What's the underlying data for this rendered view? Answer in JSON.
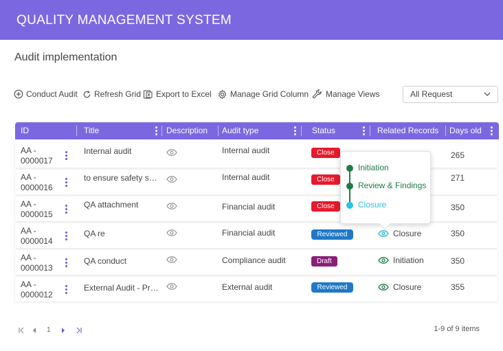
{
  "app": {
    "title": "QUALITY MANAGEMENT SYSTEM"
  },
  "page": {
    "title": "Audit implementation"
  },
  "toolbar": {
    "conduct_audit": "Conduct Audit",
    "refresh_grid": "Refresh Grid",
    "export_excel": "Export to Excel",
    "manage_columns": "Manage Grid Column",
    "manage_views": "Manage Views"
  },
  "filter": {
    "selected": "All Request"
  },
  "grid": {
    "columns": [
      "ID",
      "Title",
      "Description",
      "Audit type",
      "Status",
      "Related Records",
      "Days old"
    ],
    "rows": [
      {
        "id_line1": "AA -",
        "id_line2": "0000017",
        "title": "Internal audit",
        "type": "Internal audit",
        "status": "Close",
        "related": "",
        "days": "265"
      },
      {
        "id_line1": "AA -",
        "id_line2": "0000016",
        "title": "to ensure safety sta...",
        "type": "Internal audit",
        "status": "Close",
        "related": "",
        "days": "271"
      },
      {
        "id_line1": "AA -",
        "id_line2": "0000015",
        "title": "QA attachment",
        "type": "Financial audit",
        "status": "Close",
        "related": "",
        "days": "350"
      },
      {
        "id_line1": "AA -",
        "id_line2": "0000014",
        "title": "QA re",
        "type": "Financial audit",
        "status": "Reviewed",
        "related": "Closure",
        "days": "350"
      },
      {
        "id_line1": "AA -",
        "id_line2": "0000013",
        "title": "QA conduct",
        "type": "Compliance audit",
        "status": "Draft",
        "related": "Initiation",
        "days": "350"
      },
      {
        "id_line1": "AA -",
        "id_line2": "0000012",
        "title": "External Audit - Pro...",
        "type": "External audit",
        "status": "Reviewed",
        "related": "Closure",
        "days": "355"
      }
    ]
  },
  "popover": {
    "steps": [
      {
        "label": "Initiation",
        "color": "#1e7b46"
      },
      {
        "label": "Review & Findings",
        "color": "#1e7b46"
      },
      {
        "label": "Closure",
        "color": "#29c4e6"
      }
    ]
  },
  "pager": {
    "page": "1",
    "info": "1-9 of 9 items"
  },
  "colors": {
    "accent": "#7b68e0",
    "close": "#e8192c",
    "reviewed": "#1f78c8",
    "draft": "#8a1f78"
  }
}
